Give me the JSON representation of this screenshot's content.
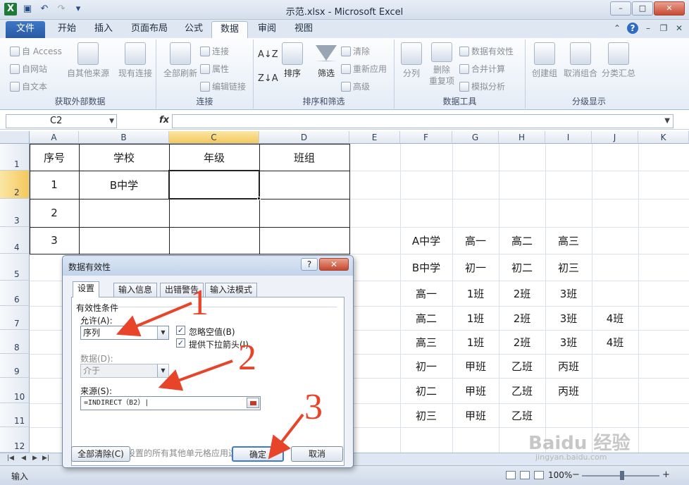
{
  "window": {
    "title": "示范.xlsx - Microsoft Excel",
    "controls": [
      "–",
      "□",
      "✕"
    ]
  },
  "ribbon_tabs": [
    "文件",
    "开始",
    "插入",
    "页面布局",
    "公式",
    "数据",
    "审阅",
    "视图"
  ],
  "ribbon": {
    "get_external": {
      "label": "获取外部数据",
      "items": [
        "自 Access",
        "自网站",
        "自文本",
        "自其他来源",
        "现有连接"
      ]
    },
    "connections": {
      "label": "连接",
      "items": [
        "全部刷新",
        "连接",
        "属性",
        "编辑链接"
      ]
    },
    "sort_filter": {
      "label": "排序和筛选",
      "items": [
        "排序",
        "筛选",
        "清除",
        "重新应用",
        "高级"
      ]
    },
    "data_tools": {
      "label": "数据工具",
      "items": [
        "分列",
        "删除\n重复项",
        "数据有效性",
        "合并计算",
        "模拟分析"
      ]
    },
    "outline": {
      "label": "分级显示",
      "items": [
        "创建组",
        "取消组合",
        "分类汇总"
      ]
    }
  },
  "formula_bar": {
    "name_box": "C2",
    "fx": "fx",
    "formula": ""
  },
  "columns": [
    "A",
    "B",
    "C",
    "D",
    "E",
    "F",
    "G",
    "H",
    "I",
    "J",
    "K"
  ],
  "rows": [
    "1",
    "2",
    "3",
    "4",
    "5",
    "6",
    "7",
    "8",
    "9",
    "10",
    "11",
    "12"
  ],
  "table": {
    "headers": [
      "序号",
      "学校",
      "年级",
      "班组"
    ],
    "rows": [
      [
        "1",
        "B中学",
        "",
        ""
      ],
      [
        "2",
        "",
        "",
        ""
      ],
      [
        "3",
        "",
        "",
        ""
      ]
    ]
  },
  "lookup_table": [
    [
      "A中学",
      "高一",
      "高二",
      "高三",
      ""
    ],
    [
      "B中学",
      "初一",
      "初二",
      "初三",
      ""
    ],
    [
      "高一",
      "1班",
      "2班",
      "3班",
      ""
    ],
    [
      "高二",
      "1班",
      "2班",
      "3班",
      "4班"
    ],
    [
      "高三",
      "1班",
      "2班",
      "3班",
      "4班"
    ],
    [
      "初一",
      "甲班",
      "乙班",
      "丙班",
      ""
    ],
    [
      "初二",
      "甲班",
      "乙班",
      "丙班",
      ""
    ],
    [
      "初三",
      "甲班",
      "乙班",
      "",
      ""
    ]
  ],
  "dialog": {
    "title": "数据有效性",
    "tabs": [
      "设置",
      "输入信息",
      "出错警告",
      "输入法模式"
    ],
    "section": "有效性条件",
    "allow_label": "允许(A):",
    "allow_value": "序列",
    "data_label": "数据(D):",
    "data_value": "介于",
    "ignore_blank": "忽略空值(B)",
    "dropdown": "提供下拉箭头(I)",
    "source_label": "来源(S):",
    "source_value": "=INDIRECT（B2）|",
    "apply_all": "对有同样设置的所有其他单元格应用这些更改(P)",
    "clear_all": "全部清除(C)",
    "ok": "确定",
    "cancel": "取消"
  },
  "annotations": [
    "1",
    "2",
    "3"
  ],
  "status": {
    "mode": "输入",
    "zoom": "100%"
  },
  "watermark": {
    "main": "Baidu 经验",
    "sub": "jingyan.baidu.com"
  }
}
